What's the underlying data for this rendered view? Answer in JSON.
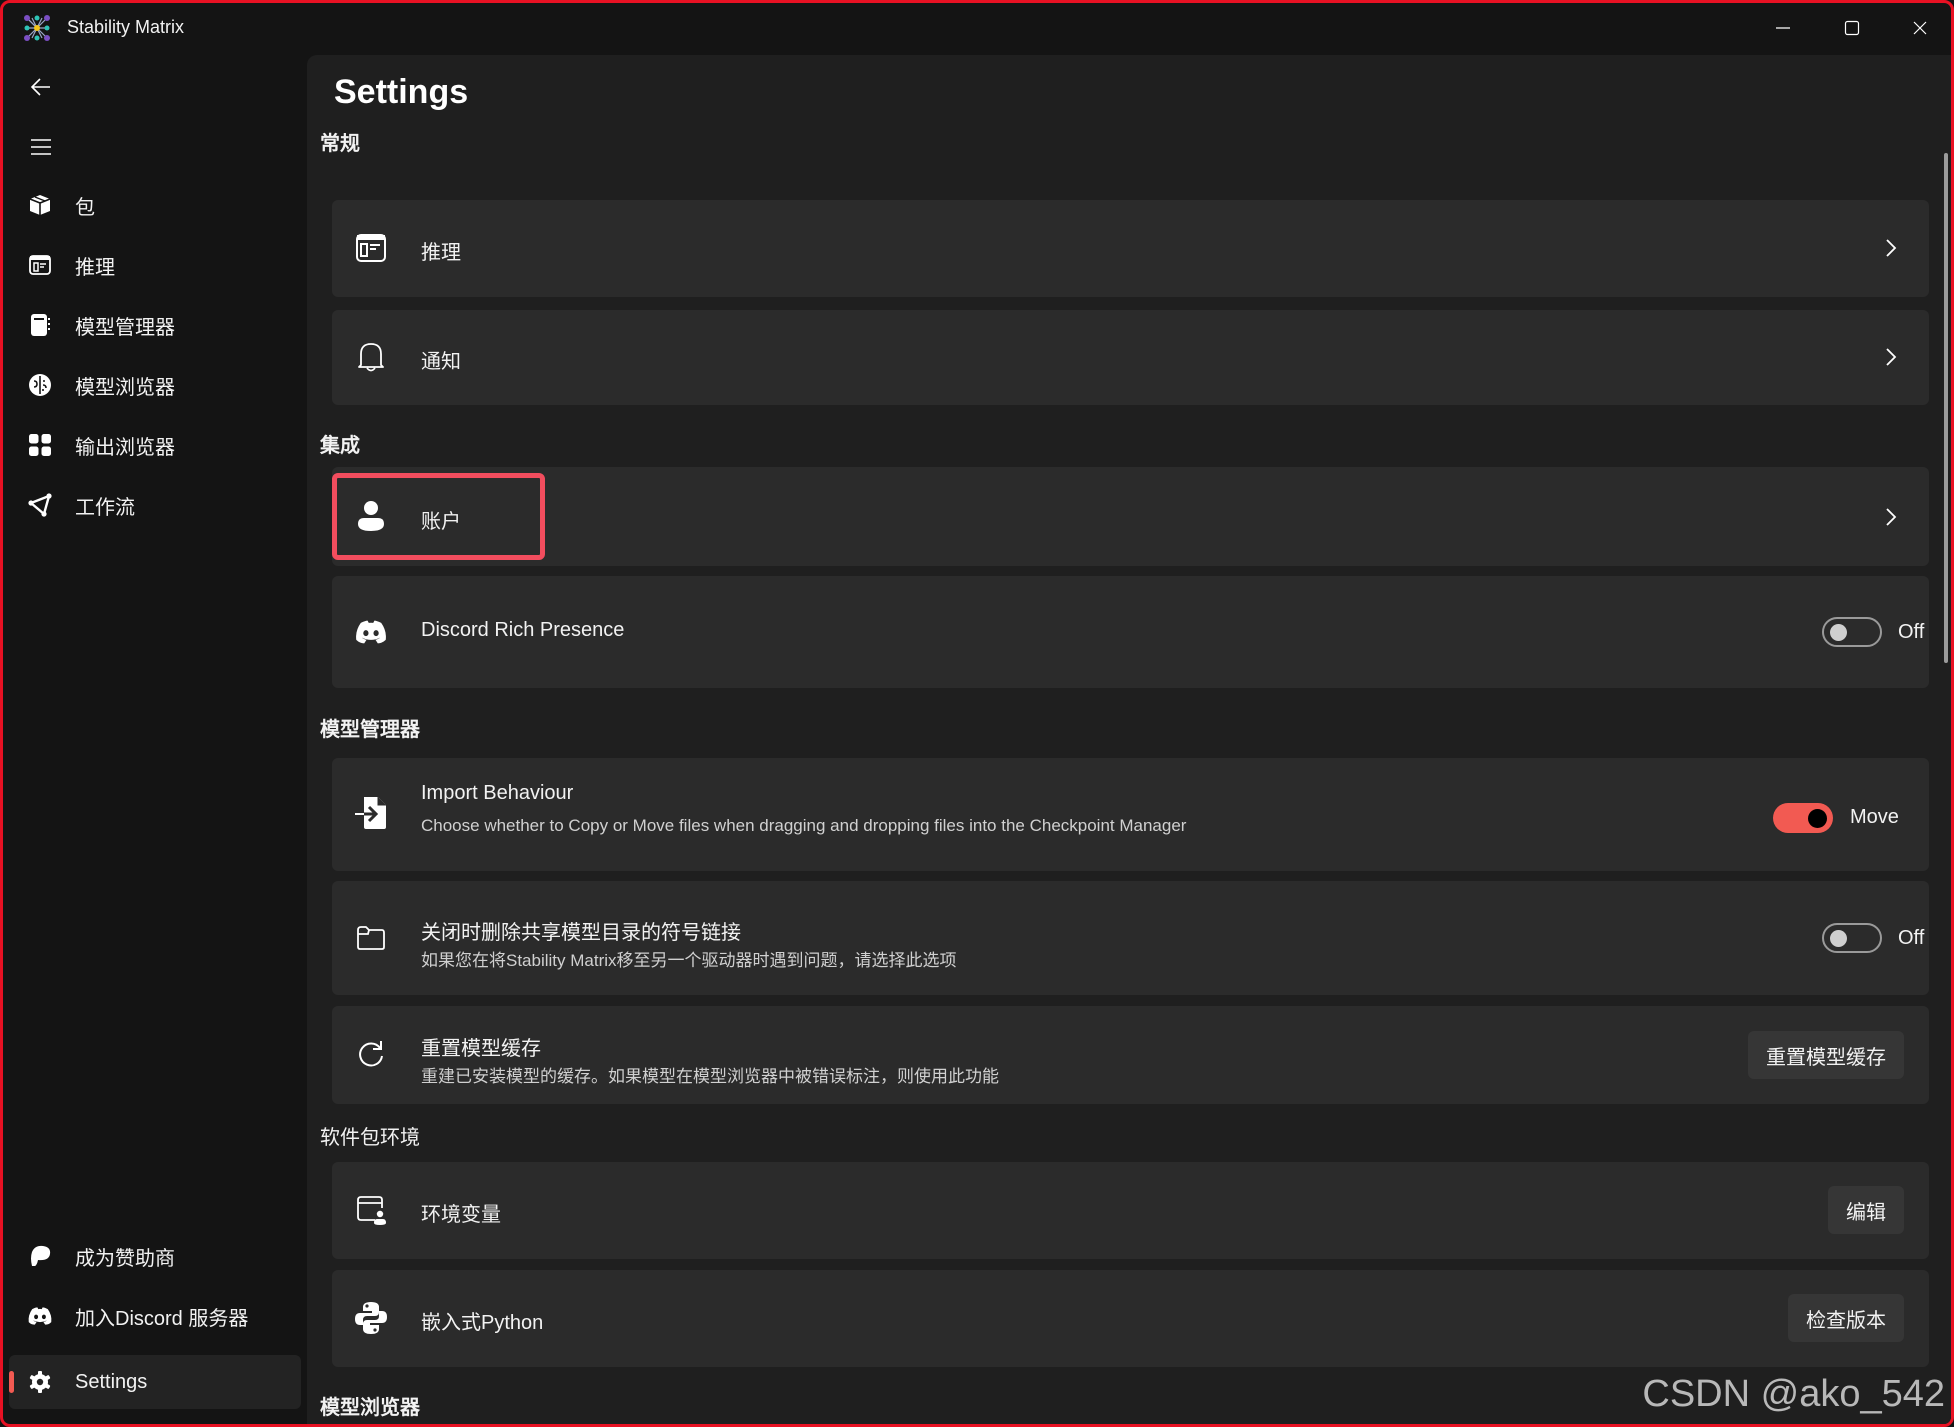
{
  "window": {
    "title": "Stability Matrix",
    "controls": {
      "minimize": "minimize",
      "maximize": "maximize",
      "close": "close"
    }
  },
  "sidebar": {
    "back_icon": "arrow-left-icon",
    "menu_icon": "hamburger-icon",
    "items": [
      {
        "label": "包",
        "icon": "box-icon"
      },
      {
        "label": "推理",
        "icon": "inference-window-icon"
      },
      {
        "label": "模型管理器",
        "icon": "notebook-icon"
      },
      {
        "label": "模型浏览器",
        "icon": "brain-icon"
      },
      {
        "label": "输出浏览器",
        "icon": "grid-icon"
      },
      {
        "label": "工作流",
        "icon": "workflow-icon"
      }
    ],
    "footer_items": [
      {
        "label": "成为赞助商",
        "icon": "patreon-icon"
      },
      {
        "label": "加入Discord 服务器",
        "icon": "discord-icon"
      },
      {
        "label": "Settings",
        "icon": "gear-icon",
        "selected": true
      }
    ],
    "accent_color": "#f25a52"
  },
  "page": {
    "title": "Settings",
    "sections": [
      {
        "header": "常规",
        "cards": [
          {
            "title": "推理",
            "icon": "inference-window-icon",
            "action": "chevron"
          },
          {
            "title": "通知",
            "icon": "bell-icon",
            "action": "chevron"
          }
        ]
      },
      {
        "header": "集成",
        "cards": [
          {
            "title": "账户",
            "icon": "person-icon",
            "action": "chevron",
            "highlighted": true
          },
          {
            "title": "Discord Rich Presence",
            "icon": "discord-icon",
            "action": "toggle",
            "toggle_on": false,
            "toggle_label": "Off"
          }
        ]
      },
      {
        "header": "模型管理器",
        "cards": [
          {
            "title": "Import Behaviour",
            "description": "Choose whether to Copy or Move files when dragging and dropping files into the Checkpoint Manager",
            "icon": "import-file-icon",
            "action": "toggle",
            "toggle_on": true,
            "toggle_label": "Move"
          },
          {
            "title": "关闭时删除共享模型目录的符号链接",
            "description": "如果您在将Stability Matrix移至另一个驱动器时遇到问题，请选择此选项",
            "icon": "folder-icon",
            "action": "toggle",
            "toggle_on": false,
            "toggle_label": "Off"
          },
          {
            "title": "重置模型缓存",
            "description": "重建已安装模型的缓存。如果模型在模型浏览器中被错误标注，则使用此功能",
            "icon": "refresh-icon",
            "action": "button",
            "button_label": "重置模型缓存"
          }
        ]
      },
      {
        "header": "软件包环境",
        "cards": [
          {
            "title": "环境变量",
            "icon": "window-person-icon",
            "action": "button",
            "button_label": "编辑"
          },
          {
            "title": "嵌入式Python",
            "icon": "python-icon",
            "action": "button",
            "button_label": "检查版本"
          }
        ]
      },
      {
        "header": "模型浏览器"
      }
    ]
  },
  "watermark": "CSDN @ako_542",
  "colors": {
    "toggle_on": "#f25a52",
    "highlight_box": "#f24d5e",
    "window_border": "#e81123"
  }
}
